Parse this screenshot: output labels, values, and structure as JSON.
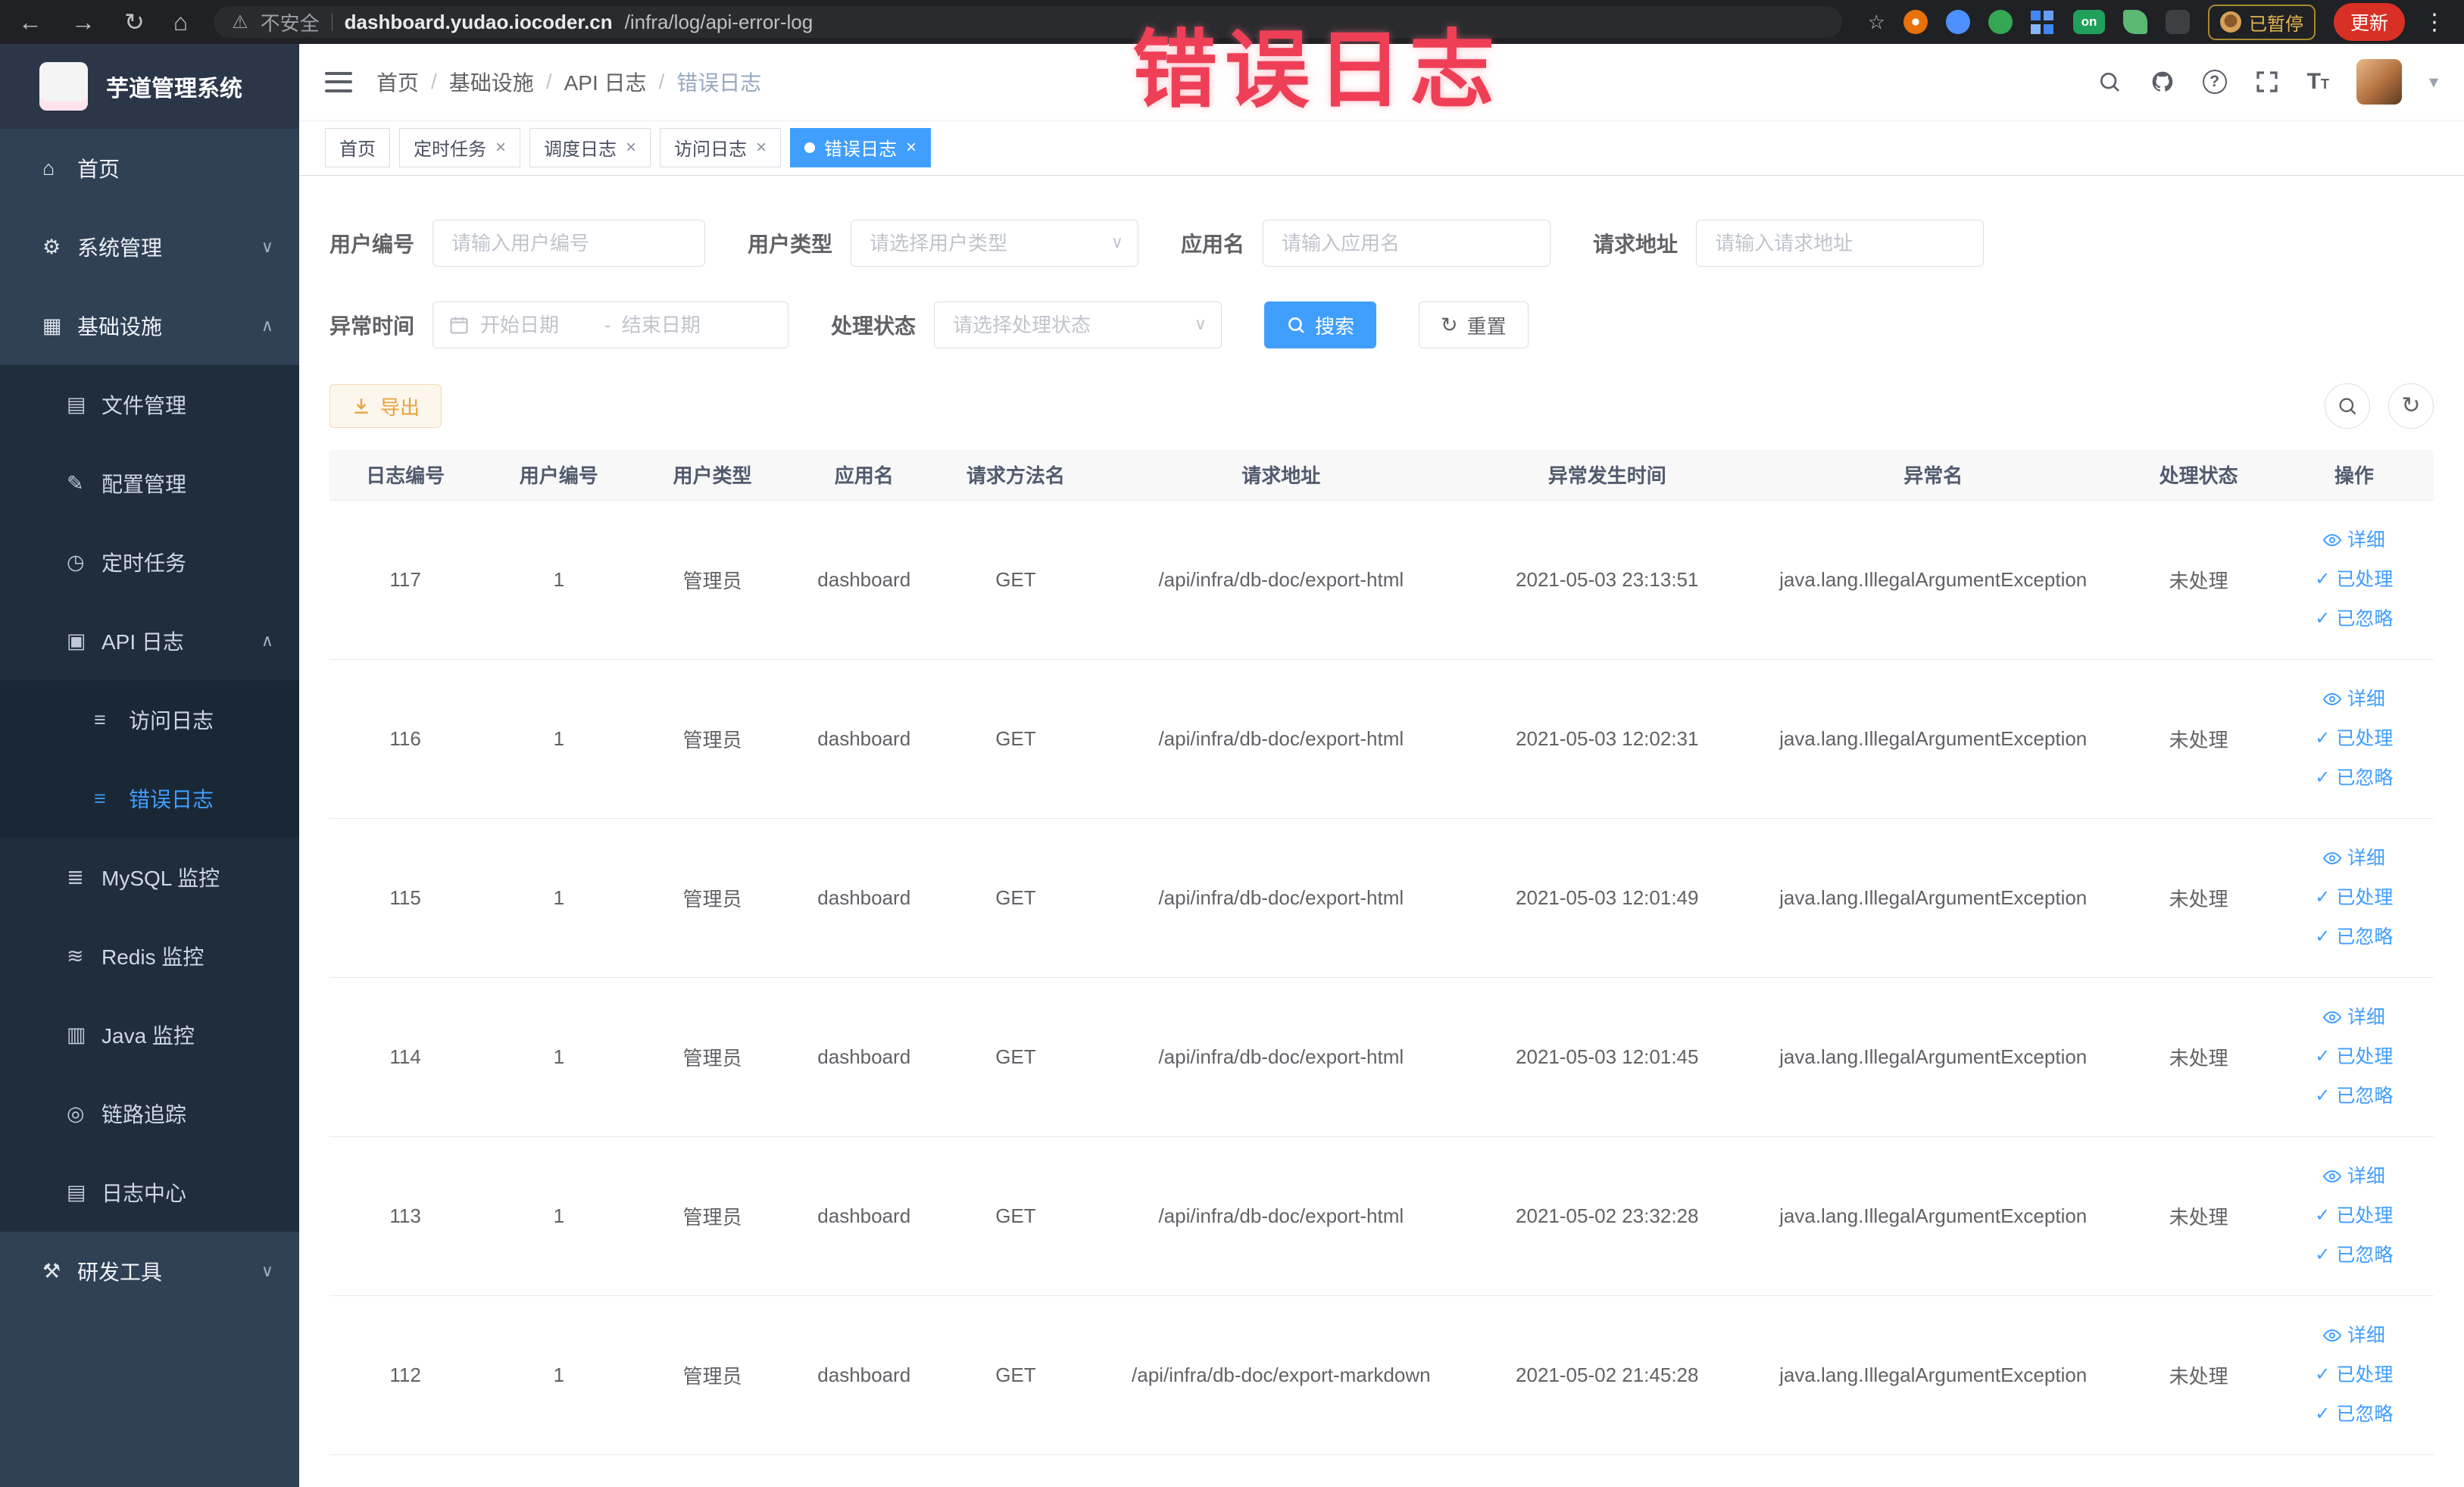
{
  "browser": {
    "security_label": "不安全",
    "url_domain": "dashboard.yudao.iocoder.cn",
    "url_path": "/infra/log/api-error-log",
    "extension_on_badge": "on",
    "paused_badge": "已暂停",
    "update_button": "更新"
  },
  "annotation": {
    "text": "错误日志",
    "color": "#ee3f56"
  },
  "colors": {
    "accent": "#409eff",
    "warning": "#e6a23c",
    "sidebar": "#304156",
    "tag_active": "#409eff"
  },
  "icons": {
    "back": "←",
    "forward": "→",
    "reload": "↻",
    "home_chrome": "⌂",
    "warning": "⚠",
    "star": "☆",
    "more": "⋮",
    "home": "⌂",
    "gear": "⚙",
    "infra": "▦",
    "file": "▤",
    "config": "✎",
    "cron": "◷",
    "apilog": "▣",
    "doc": "≡",
    "mysql": "≣",
    "redis": "≋",
    "java": "▥",
    "trace": "◎",
    "logcenter": "▤",
    "tools": "⚒",
    "chevron_down": "∨",
    "chevron_up": "∧",
    "caret_down": "▾",
    "refresh": "↻",
    "close": "×",
    "check": "✓"
  },
  "sidebar": {
    "logo_title": "芋道管理系统",
    "items": [
      {
        "label": "首页"
      },
      {
        "label": "系统管理"
      },
      {
        "label": "基础设施"
      },
      {
        "label": "文件管理"
      },
      {
        "label": "配置管理"
      },
      {
        "label": "定时任务"
      },
      {
        "label": "API 日志"
      },
      {
        "label": "访问日志"
      },
      {
        "label": "错误日志"
      },
      {
        "label": "MySQL 监控"
      },
      {
        "label": "Redis 监控"
      },
      {
        "label": "Java 监控"
      },
      {
        "label": "链路追踪"
      },
      {
        "label": "日志中心"
      },
      {
        "label": "研发工具"
      }
    ]
  },
  "breadcrumb": {
    "separator": "/",
    "items": [
      "首页",
      "基础设施",
      "API 日志",
      "错误日志"
    ]
  },
  "tabs": [
    {
      "label": "首页",
      "closable": false,
      "active": false
    },
    {
      "label": "定时任务",
      "closable": true,
      "active": false
    },
    {
      "label": "调度日志",
      "closable": true,
      "active": false
    },
    {
      "label": "访问日志",
      "closable": true,
      "active": false
    },
    {
      "label": "错误日志",
      "closable": true,
      "active": true
    }
  ],
  "filters": {
    "user_id": {
      "label": "用户编号",
      "placeholder": "请输入用户编号"
    },
    "user_type": {
      "label": "用户类型",
      "placeholder": "请选择用户类型"
    },
    "app_name": {
      "label": "应用名",
      "placeholder": "请输入应用名"
    },
    "request_url": {
      "label": "请求地址",
      "placeholder": "请输入请求地址"
    },
    "exception_time": {
      "label": "异常时间",
      "start_placeholder": "开始日期",
      "range_separator": "-",
      "end_placeholder": "结束日期"
    },
    "process_status": {
      "label": "处理状态",
      "placeholder": "请选择处理状态"
    },
    "search_button": "搜索",
    "reset_button": "重置"
  },
  "toolbar": {
    "export_button": "导出"
  },
  "table": {
    "columns": [
      "日志编号",
      "用户编号",
      "用户类型",
      "应用名",
      "请求方法名",
      "请求地址",
      "异常发生时间",
      "异常名",
      "处理状态",
      "操作"
    ],
    "actions": {
      "detail": "详细",
      "processed": "已处理",
      "ignored": "已忽略"
    },
    "rows": [
      {
        "id": "117",
        "user_id": "1",
        "user_type": "管理员",
        "app_name": "dashboard",
        "method": "GET",
        "url": "/api/infra/db-doc/export-html",
        "time": "2021-05-03 23:13:51",
        "exception": "java.lang.IllegalArgumentException",
        "status": "未处理"
      },
      {
        "id": "116",
        "user_id": "1",
        "user_type": "管理员",
        "app_name": "dashboard",
        "method": "GET",
        "url": "/api/infra/db-doc/export-html",
        "time": "2021-05-03 12:02:31",
        "exception": "java.lang.IllegalArgumentException",
        "status": "未处理"
      },
      {
        "id": "115",
        "user_id": "1",
        "user_type": "管理员",
        "app_name": "dashboard",
        "method": "GET",
        "url": "/api/infra/db-doc/export-html",
        "time": "2021-05-03 12:01:49",
        "exception": "java.lang.IllegalArgumentException",
        "status": "未处理"
      },
      {
        "id": "114",
        "user_id": "1",
        "user_type": "管理员",
        "app_name": "dashboard",
        "method": "GET",
        "url": "/api/infra/db-doc/export-html",
        "time": "2021-05-03 12:01:45",
        "exception": "java.lang.IllegalArgumentException",
        "status": "未处理"
      },
      {
        "id": "113",
        "user_id": "1",
        "user_type": "管理员",
        "app_name": "dashboard",
        "method": "GET",
        "url": "/api/infra/db-doc/export-html",
        "time": "2021-05-02 23:32:28",
        "exception": "java.lang.IllegalArgumentException",
        "status": "未处理"
      },
      {
        "id": "112",
        "user_id": "1",
        "user_type": "管理员",
        "app_name": "dashboard",
        "method": "GET",
        "url": "/api/infra/db-doc/export-markdown",
        "time": "2021-05-02 21:45:28",
        "exception": "java.lang.IllegalArgumentException",
        "status": "未处理"
      }
    ]
  }
}
